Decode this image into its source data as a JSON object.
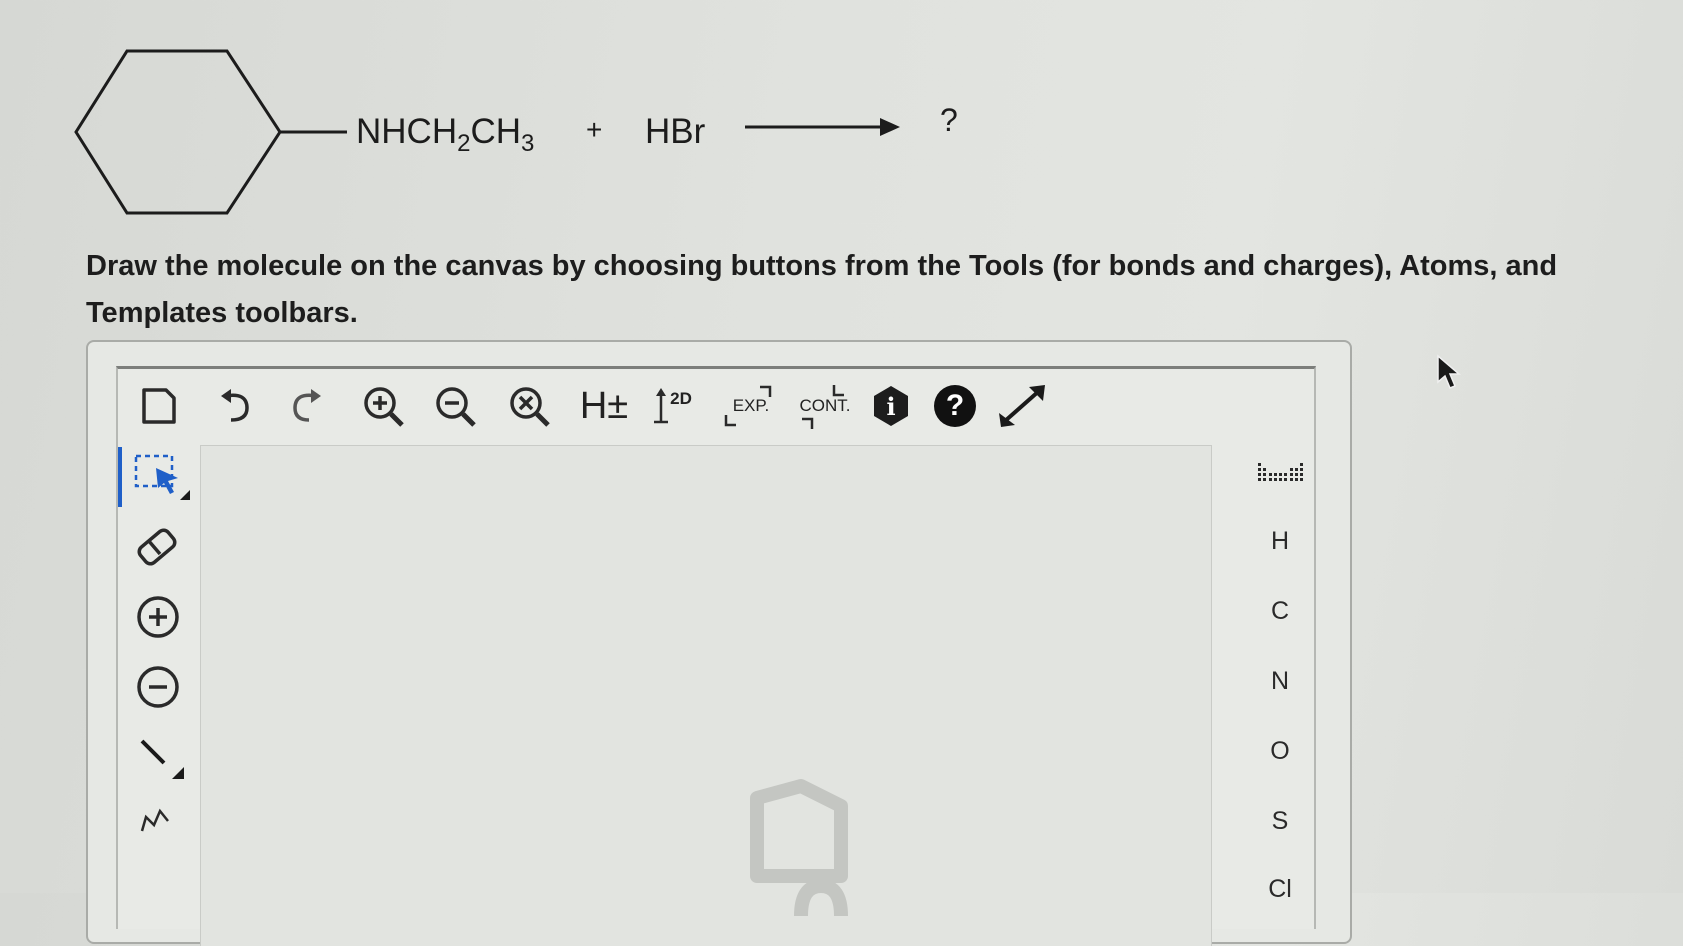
{
  "reaction": {
    "reactant_text": "NHCH",
    "reactant_sub1": "2",
    "reactant_text2": "CH",
    "reactant_sub2": "3",
    "plus": "+",
    "reagent": "HBr",
    "product": "?"
  },
  "instructions": "Draw the molecule on the canvas by choosing buttons from the Tools (for bonds and charges), Atoms, and Templates toolbars.",
  "toolbar": {
    "h_toggle_label": "H±",
    "clean_2d_label": "2D",
    "expand_label": "EXP.",
    "contract_label": "CONT.",
    "info_label": "i",
    "help_label": "?"
  },
  "atoms": [
    "H",
    "C",
    "N",
    "O",
    "S",
    "Cl"
  ],
  "icons": {
    "new": "new-document-icon",
    "undo": "undo-icon",
    "redo": "redo-icon",
    "zoom_in": "zoom-in-icon",
    "zoom_out": "zoom-out-icon",
    "reset_zoom": "zoom-reset-icon",
    "fullscreen": "fullscreen-icon",
    "select": "selection-icon",
    "erase": "eraser-icon",
    "charge_plus": "positive-charge-icon",
    "charge_minus": "negative-charge-icon",
    "single_bond": "single-bond-icon",
    "chain": "chain-icon",
    "periodic_table": "periodic-table-icon"
  },
  "colors": {
    "select_accent": "#1f5fc8",
    "info_bg": "#1d1d1d"
  }
}
